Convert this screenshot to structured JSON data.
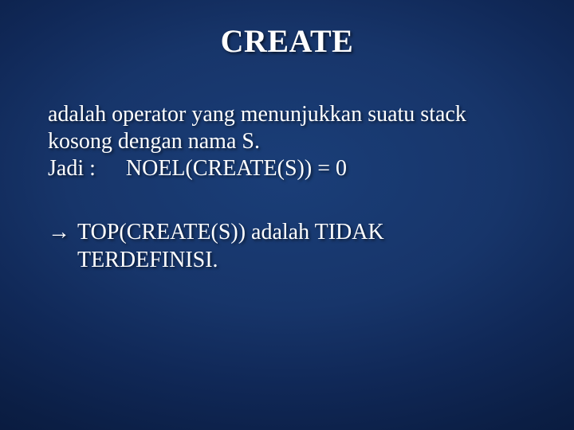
{
  "slide": {
    "title": "CREATE",
    "line1": "adalah operator yang menunjukkan suatu stack",
    "line2": "kosong dengan nama S.",
    "jadi_label": "Jadi :",
    "jadi_expr": "NOEL(CREATE(S)) = 0",
    "arrow": "→",
    "result_line1": "TOP(CREATE(S)) adalah TIDAK",
    "result_line2": "TERDEFINISI."
  }
}
